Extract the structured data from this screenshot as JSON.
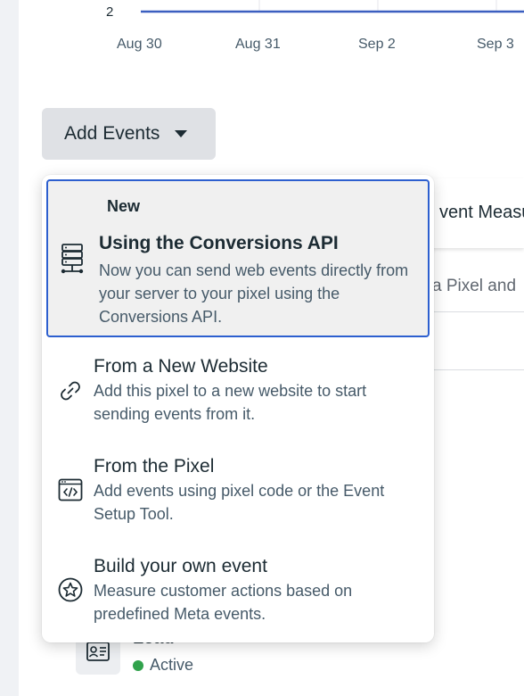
{
  "chart": {
    "y_tick": "2",
    "x_ticks": [
      "Aug 30",
      "Aug 31",
      "Sep 2",
      "Sep 3"
    ],
    "line_color": "#3b5fc0"
  },
  "add_events": {
    "label": "Add Events"
  },
  "menu": {
    "featured": {
      "badge": "New",
      "title": "Using the Conversions API",
      "description": "Now you can send web events directly from your server to your pixel using the Conversions API.",
      "icon": "server-icon"
    },
    "items": [
      {
        "title": "From a New Website",
        "description": "Add this pixel to a new website to start sending events from it.",
        "icon": "link-icon"
      },
      {
        "title": "From the Pixel",
        "description": "Add events using pixel code or the Event Setup Tool.",
        "icon": "code-window-icon"
      },
      {
        "title": "Build your own event",
        "description": "Measure customer actions based on predefined Meta events.",
        "icon": "star-circle-icon"
      }
    ]
  },
  "background": {
    "card_text": "vent Measu",
    "row_text": "a Pixel and",
    "lead_title": "Lead",
    "lead_status": "Active"
  },
  "colors": {
    "accent": "#2d5fcf",
    "active": "#31a24c"
  }
}
